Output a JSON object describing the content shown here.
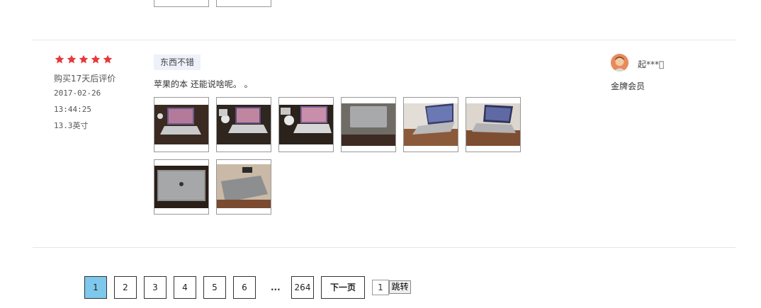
{
  "review": {
    "rating": 5,
    "purchase_note": "购买17天后评价",
    "date": "2017-02-26",
    "time": "13:44:25",
    "spec": "13.3英寸",
    "tag": "东西不错",
    "comment": "苹果的本 还能说啥呢。 。",
    "photos": [
      "photo-1",
      "photo-2",
      "photo-3",
      "photo-4",
      "photo-5",
      "photo-6",
      "photo-7",
      "photo-8"
    ]
  },
  "user": {
    "name": "起***\u0000",
    "level": "金牌会员"
  },
  "pagination": {
    "pages": [
      "1",
      "2",
      "3",
      "4",
      "5",
      "6"
    ],
    "ellipsis": "...",
    "last": "264",
    "next_label": "下一页",
    "jump_value": "1",
    "jump_label": "跳转"
  },
  "colors": {
    "star": "#e4393c",
    "active_page": "#7ec8ec",
    "tag_bg": "#eef1fa"
  }
}
